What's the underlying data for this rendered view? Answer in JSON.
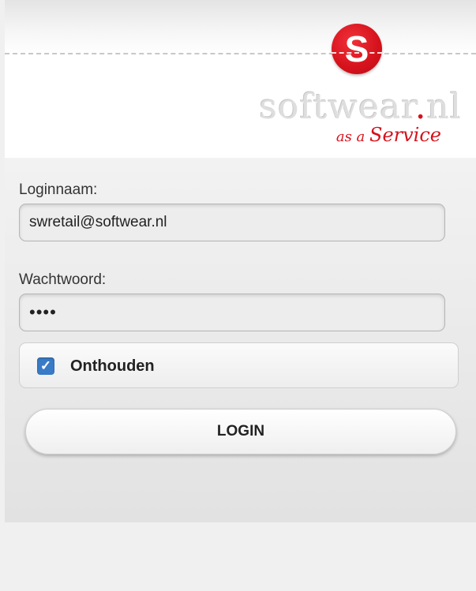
{
  "branding": {
    "badge_letter": "S",
    "brand_main": "softwear",
    "brand_dot": ".",
    "brand_tld": "nl",
    "tagline_prefix": "as a ",
    "tagline_service": "Service",
    "accent_color": "#d5121c"
  },
  "form": {
    "username_label": "Loginnaam:",
    "username_value": "swretail@softwear.nl",
    "password_label": "Wachtwoord:",
    "password_masked": "••••",
    "remember_label": "Onthouden",
    "remember_checked": true,
    "checkbox_color": "#3a7bc8",
    "login_label": "LOGIN"
  }
}
